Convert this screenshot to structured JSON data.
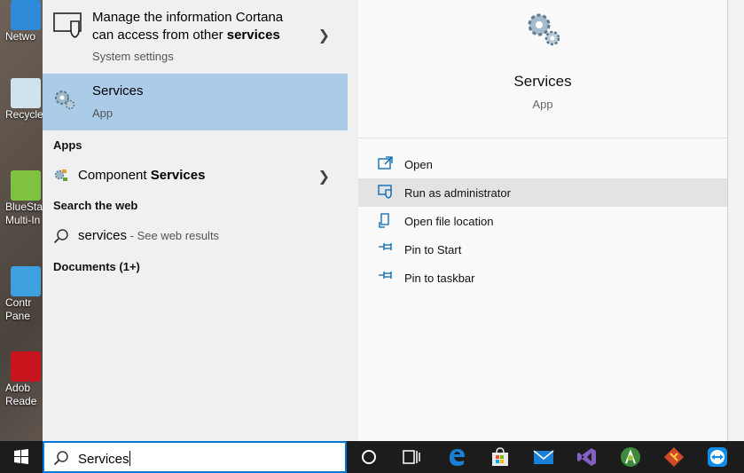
{
  "desktop": {
    "icons": [
      {
        "label": "Netwo",
        "icon": "network-icon"
      },
      {
        "label": "Recycle",
        "icon": "recycle-bin-icon"
      },
      {
        "label": "BlueSta",
        "label2": "Multi-In",
        "icon": "bluestacks-icon"
      },
      {
        "label": "Contr",
        "label2": "Pane",
        "icon": "control-panel-icon"
      },
      {
        "label": "Adob",
        "label2": "Reade",
        "icon": "adobe-reader-icon"
      }
    ]
  },
  "results": {
    "cortana": {
      "title_plain": "Manage the information Cortana",
      "title_plain2": "can access from other ",
      "title_bold": "services",
      "subtitle": "System settings"
    },
    "best_match": {
      "title": "Services",
      "subtitle": "App"
    },
    "apps_header": "Apps",
    "component_services": {
      "prefix": "Component ",
      "bold": "Services"
    },
    "web_header": "Search the web",
    "web_result": {
      "query": "services",
      "suffix": " - See web results"
    },
    "documents_header": "Documents (1+)"
  },
  "detail": {
    "title": "Services",
    "subtitle": "App",
    "actions": [
      {
        "label": "Open",
        "icon": "open-icon"
      },
      {
        "label": "Run as administrator",
        "icon": "shield-icon"
      },
      {
        "label": "Open file location",
        "icon": "file-location-icon"
      },
      {
        "label": "Pin to Start",
        "icon": "pin-icon"
      },
      {
        "label": "Pin to taskbar",
        "icon": "pin-icon"
      }
    ]
  },
  "taskbar": {
    "search_value": "Services",
    "apps": [
      "cortana-icon",
      "task-view-icon",
      "edge-icon",
      "store-icon",
      "mail-icon",
      "visual-studio-icon",
      "android-studio-icon",
      "git-icon",
      "teamviewer-icon"
    ]
  },
  "colors": {
    "selected": "#aacce9",
    "accent": "#0078d7",
    "taskbar": "#1c1c1c"
  }
}
